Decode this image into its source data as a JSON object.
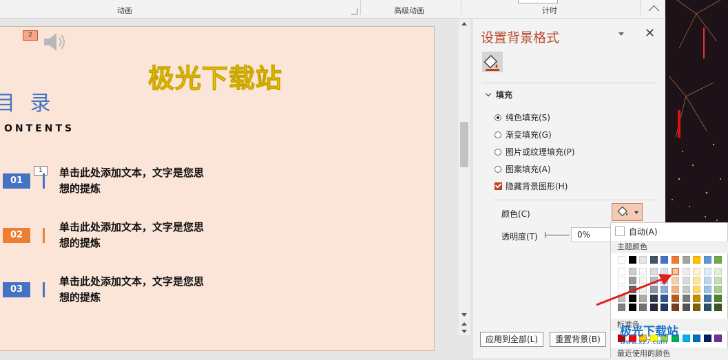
{
  "ribbon": {
    "groups": [
      "动画",
      "高级动画",
      "计时"
    ]
  },
  "slide": {
    "page_badge": "2",
    "title": "极光下载站",
    "heading": "目 录",
    "subheading": "ONTENTS",
    "animation_tag": "1",
    "items": [
      {
        "num": "01",
        "text": "单击此处添加文本，文字是您思想的提炼",
        "color": "#4472c4"
      },
      {
        "num": "02",
        "text": "单击此处添加文本，文字是您思想的提炼",
        "color": "#ed7d31"
      },
      {
        "num": "03",
        "text": "单击此处添加文本，文字是您思想的提炼",
        "color": "#4472c4"
      }
    ],
    "background": "#fbe5d9"
  },
  "pane": {
    "title": "设置背景格式",
    "close": "✕",
    "section": "填充",
    "options": [
      {
        "label": "纯色填充(S)",
        "selected": true
      },
      {
        "label": "渐变填充(G)",
        "selected": false
      },
      {
        "label": "图片或纹理填充(P)",
        "selected": false
      },
      {
        "label": "图案填充(A)",
        "selected": false
      }
    ],
    "hide_graphics": "隐藏背景图形(H)",
    "color_label": "颜色(C)",
    "transparency_label": "透明度(T)",
    "transparency_value": "0%",
    "apply_all": "应用到全部(L)",
    "reset": "重置背景(B)"
  },
  "palette": {
    "auto": "自动(A)",
    "theme_header": "主题颜色",
    "standard_header": "标准色",
    "recent_header": "最近使用的颜色",
    "theme_colors": [
      "#ffffff",
      "#000000",
      "#e7e6e6",
      "#44546a",
      "#4472c4",
      "#ed7d31",
      "#a5a5a5",
      "#ffc000",
      "#5b9bd5",
      "#70ad47"
    ],
    "standard_colors": [
      "#c00000",
      "#ff0000",
      "#ffc000",
      "#ffff00",
      "#92d050",
      "#00b050",
      "#00b0f0",
      "#0070c0",
      "#002060",
      "#7030a0"
    ],
    "selected": "#f8cbad"
  },
  "watermark": {
    "text": "极光下载站",
    "url": "www.xz7.com"
  },
  "accent": "#c43e1c"
}
